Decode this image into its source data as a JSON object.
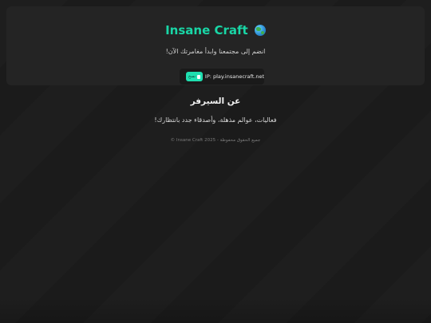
{
  "hero": {
    "title": "Insane Craft",
    "title_icon": "globe-icon",
    "subtitle": "انضم إلى مجتمعنا وابدأ مغامرتك الآن!",
    "copy_label": "نسخ",
    "copy_icon": "copy-icon",
    "ip_text": "IP: play.insanecraft.net"
  },
  "about": {
    "title": "عن السيرفر",
    "text": "فعاليات، عوالم مذهلة، وأصدقاء جدد بانتظارك!"
  },
  "footer": {
    "text": "© Insane Craft 2025 - جميع الحقوق محفوظة"
  },
  "colors": {
    "accent": "#19d6a6",
    "button": "#1fdfb0",
    "background": "#1c1c1c",
    "card": "#242424"
  }
}
